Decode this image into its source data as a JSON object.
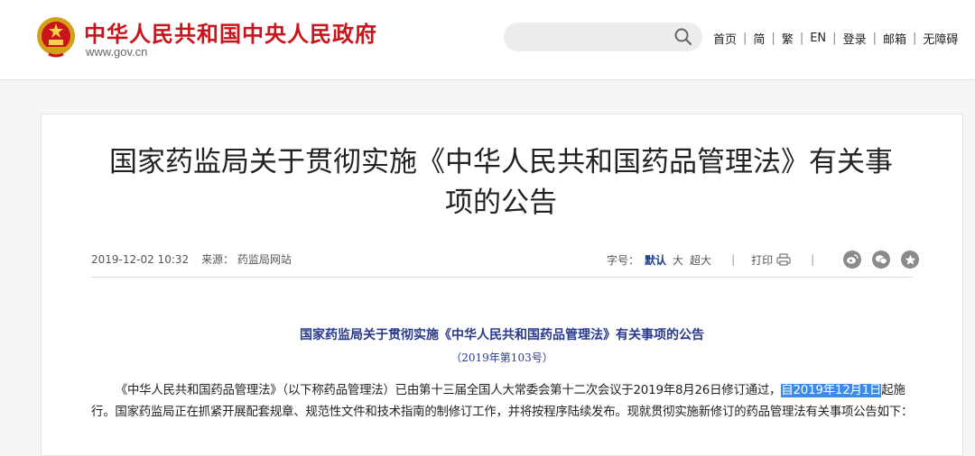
{
  "header": {
    "site_title": "中华人民共和国中央人民政府",
    "site_url": "www.gov.cn",
    "search_value": "",
    "nav": [
      "首页",
      "简",
      "繁",
      "EN",
      "登录",
      "邮箱",
      "无障碍"
    ]
  },
  "article": {
    "title_line1": "国家药监局关于贯彻实施《中华人民共和国药品管理法》有关事",
    "title_line2": "项的公告",
    "date": "2019-12-02 10:32",
    "source_label": "来源：",
    "source": "药监局网站",
    "font_label": "字号：",
    "font_default": "默认",
    "font_large": "大",
    "font_xlarge": "超大",
    "print_label": "打印",
    "doc_title": "国家药监局关于贯彻实施《中华人民共和国药品管理法》有关事项的公告",
    "doc_number": "（2019年第103号）",
    "para_before": "《中华人民共和国药品管理法》（以下称药品管理法）已由第十三届全国人大常委会第十二次会议于2019年8月26日修订通过，",
    "para_highlight": "自2019年12月1日",
    "para_after": "起施行。国家药监局正在抓紧开展配套规章、规范性文件和技术指南的制修订工作，并将按程序陆续发布。现就贯彻实施新修订的药品管理法有关事项公告如下："
  },
  "share_icons": [
    "weibo-icon",
    "wechat-icon",
    "favorite-icon"
  ],
  "colors": {
    "brand_red": "#c8141a",
    "doc_blue": "#2a3a8c",
    "highlight": "#3b8ce8"
  }
}
